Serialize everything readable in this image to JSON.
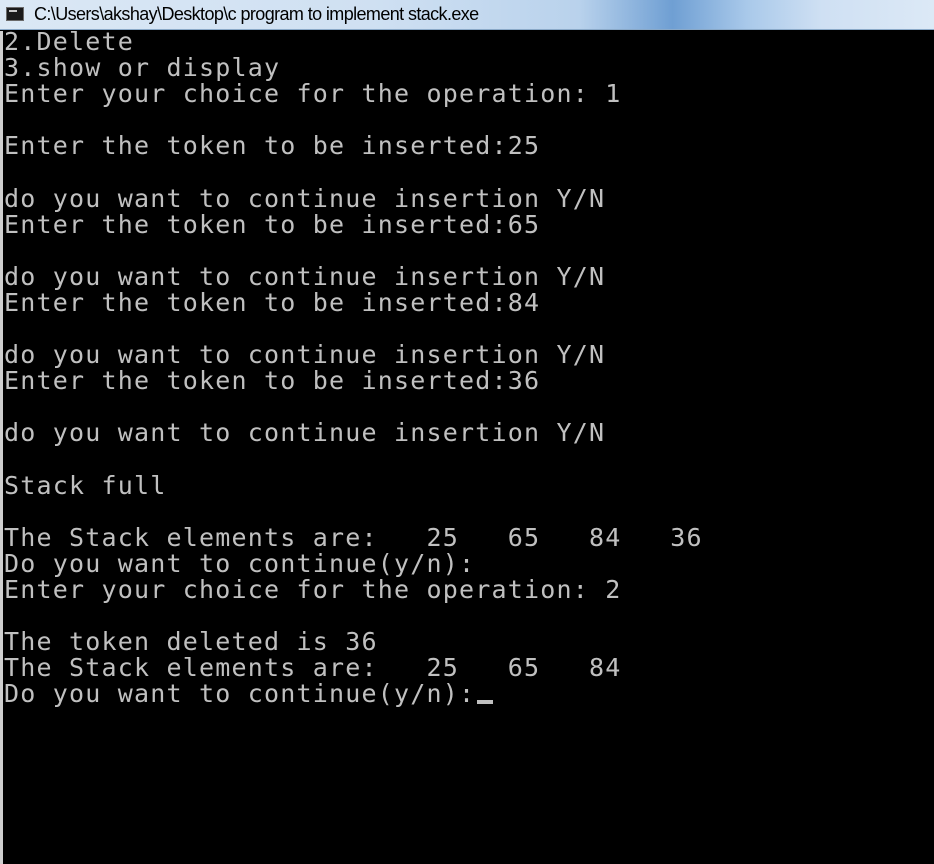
{
  "window": {
    "title": "C:\\Users\\akshay\\Desktop\\c program to implement stack.exe",
    "icon": "console-app-icon"
  },
  "console": {
    "lines": [
      "2.Delete",
      "3.show or display",
      "Enter your choice for the operation: 1",
      "",
      "Enter the token to be inserted:25",
      "",
      "do you want to continue insertion Y/N",
      "Enter the token to be inserted:65",
      "",
      "do you want to continue insertion Y/N",
      "Enter the token to be inserted:84",
      "",
      "do you want to continue insertion Y/N",
      "Enter the token to be inserted:36",
      "",
      "do you want to continue insertion Y/N",
      "",
      "Stack full",
      "",
      "The Stack elements are:   25   65   84   36",
      "Do you want to continue(y/n):",
      "Enter your choice for the operation: 2",
      "",
      "The token deleted is 36",
      "The Stack elements are:   25   65   84",
      "Do you want to continue(y/n):"
    ]
  },
  "colors": {
    "console_background": "#000000",
    "console_text": "#c0c0c0"
  }
}
